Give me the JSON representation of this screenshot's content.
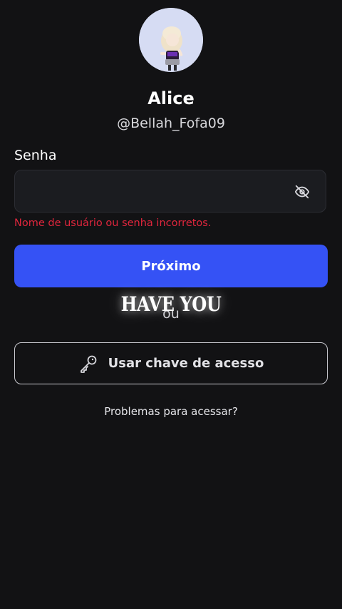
{
  "profile": {
    "display_name": "Alice",
    "username": "@Bellah_Fofa09"
  },
  "password_field": {
    "label": "Senha",
    "value": "",
    "placeholder": "",
    "toggle_icon": "eye-off-icon"
  },
  "error": {
    "message": "Nome de usuário ou senha incorretos.",
    "color": "#e1263d"
  },
  "next_button": {
    "label": "Próximo",
    "color": "#3552f5"
  },
  "overlay": {
    "caption": "HAVE YOU"
  },
  "divider": {
    "label": "ou"
  },
  "passkey_button": {
    "label": "Usar chave de acesso",
    "icon": "key-icon"
  },
  "help_link": {
    "label": "Problemas para acessar?"
  }
}
